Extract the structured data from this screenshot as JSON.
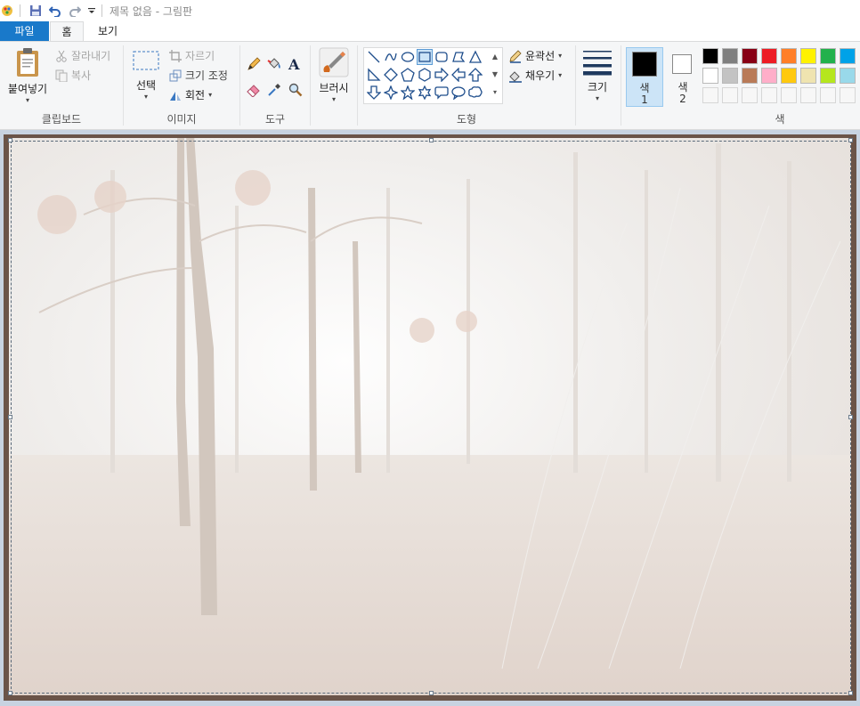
{
  "titlebar": {
    "title": "제목 없음 - 그림판"
  },
  "tabs": [
    {
      "label": "파일"
    },
    {
      "label": "홈"
    },
    {
      "label": "보기"
    }
  ],
  "clipboard": {
    "paste_label": "붙여넣기",
    "cut_label": "잘라내기",
    "copy_label": "복사",
    "group_label": "클립보드"
  },
  "image": {
    "select_label": "선택",
    "crop_label": "자르기",
    "resize_label": "크기 조정",
    "rotate_label": "회전",
    "group_label": "이미지"
  },
  "tools": {
    "group_label": "도구"
  },
  "brush": {
    "label": "브러시"
  },
  "shapes": {
    "outline_label": "윤곽선",
    "fill_label": "채우기",
    "group_label": "도형"
  },
  "size": {
    "label": "크기"
  },
  "colors": {
    "color1_label_a": "색",
    "color1_label_b": "1",
    "color2_label_a": "색",
    "color2_label_b": "2",
    "group_label": "색",
    "color1_value": "#000000",
    "color2_value": "#ffffff",
    "palette_row1": [
      "#000000",
      "#7f7f7f",
      "#880015",
      "#ed1c24",
      "#ff7f27",
      "#fff200",
      "#22b14c",
      "#00a2e8"
    ],
    "palette_row2": [
      "#ffffff",
      "#c3c3c3",
      "#b97a57",
      "#ffaec9",
      "#ffc90e",
      "#efe4b0",
      "#b5e61d",
      "#99d9ea"
    ]
  }
}
